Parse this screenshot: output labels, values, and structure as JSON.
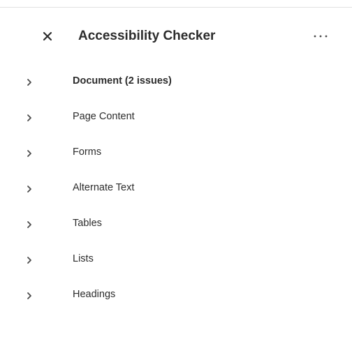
{
  "panel": {
    "title": "Accessibility Checker",
    "close_icon": "close-icon",
    "more_icon": "more-horizontal-icon"
  },
  "items": [
    {
      "label": "Document (2 issues)",
      "icon": "chevron-right-icon",
      "bold": true
    },
    {
      "label": "Page Content",
      "icon": "chevron-right-icon",
      "bold": false
    },
    {
      "label": "Forms",
      "icon": "chevron-right-icon",
      "bold": false
    },
    {
      "label": "Alternate Text",
      "icon": "chevron-right-icon",
      "bold": false
    },
    {
      "label": "Tables",
      "icon": "chevron-right-icon",
      "bold": false
    },
    {
      "label": "Lists",
      "icon": "chevron-right-icon",
      "bold": false
    },
    {
      "label": "Headings",
      "icon": "chevron-right-icon",
      "bold": false
    }
  ],
  "colors": {
    "text": "#2c2c2c",
    "icon": "#4b4b4b",
    "divider": "#e1e1e1",
    "background": "#ffffff"
  }
}
